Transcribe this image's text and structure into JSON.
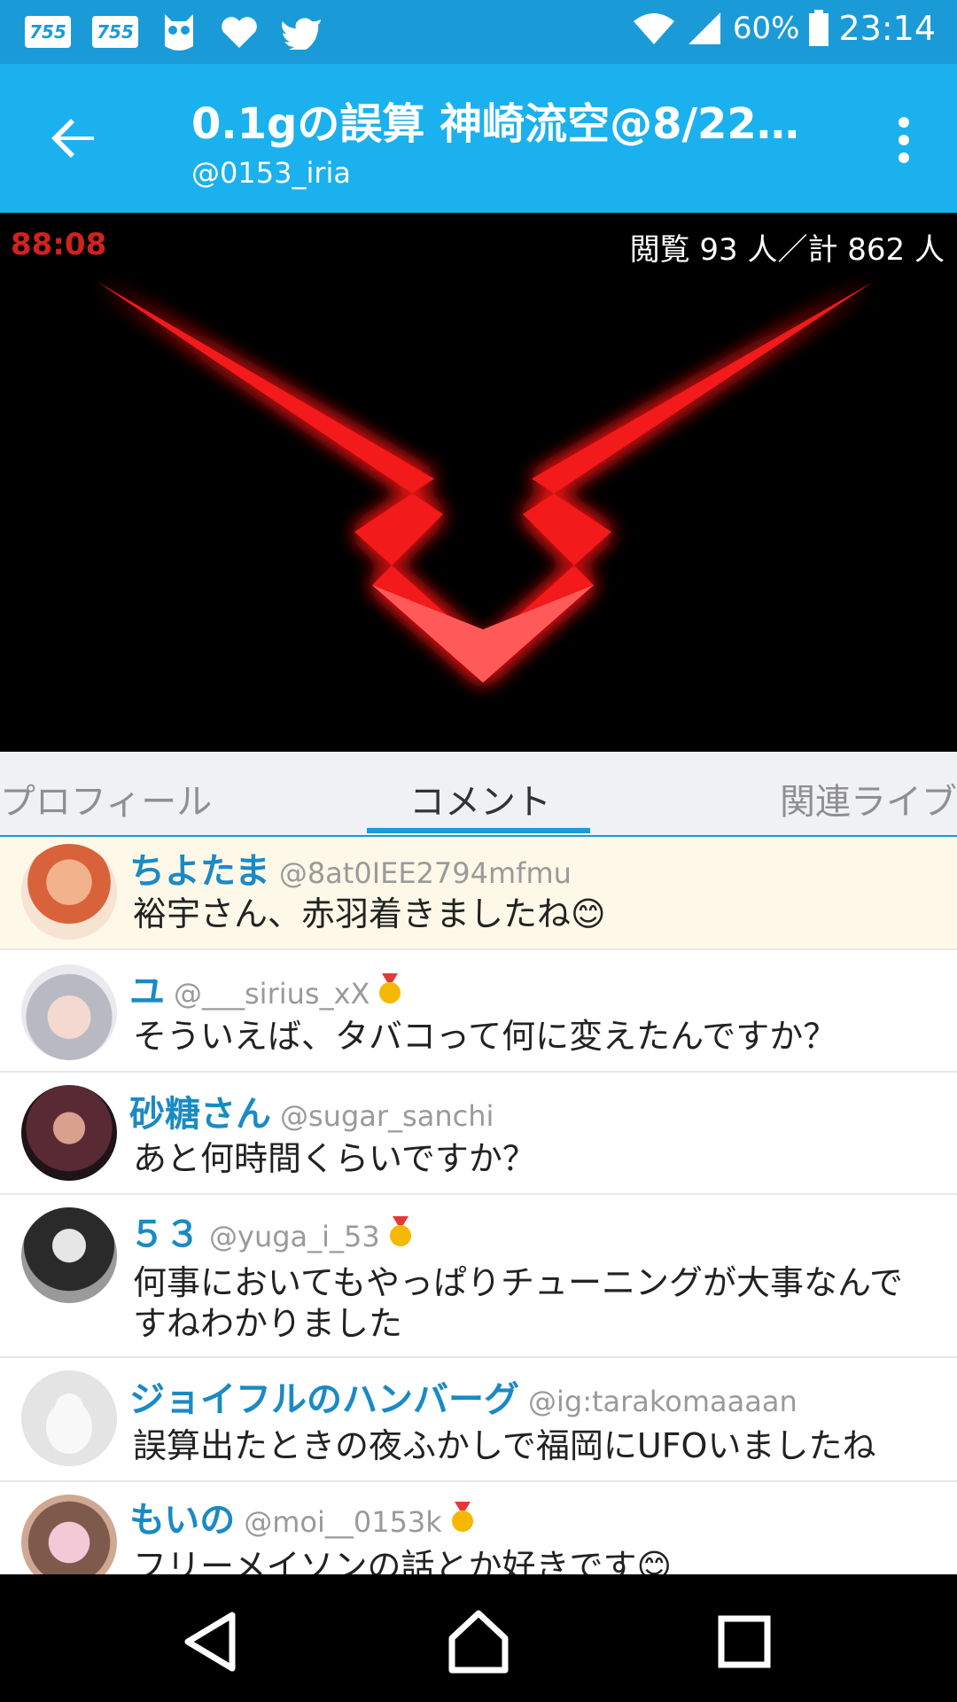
{
  "status_bar": {
    "notif_icons": [
      "755-icon",
      "755-icon",
      "owl-icon",
      "heart-icon",
      "twitter-icon"
    ],
    "badge_text": "755",
    "battery": "60%",
    "time": "23:14"
  },
  "app_bar": {
    "title": "0.1gの誤算 神崎流空@8/22…",
    "subtitle": "@0153_iria"
  },
  "video": {
    "timer": "88:08",
    "viewers": "閲覧 93 人／計 862 人"
  },
  "tabs": [
    {
      "label": "プロフィール"
    },
    {
      "label": "コメント"
    },
    {
      "label": "関連ライブ"
    }
  ],
  "comments": [
    {
      "name": "ちよたま",
      "handle": "@8at0IEE2794mfmu",
      "text": "裕宇さん、赤羽着きましたね😊",
      "medal": false
    },
    {
      "name": "ユ",
      "handle": "@___sirius_xX",
      "text": "そういえば、タバコって何に変えたんですか？",
      "medal": true
    },
    {
      "name": "砂糖さん",
      "handle": "@sugar_sanchi",
      "text": "あと何時間くらいですか？",
      "medal": false
    },
    {
      "name": "５３",
      "handle": "@yuga_i_53",
      "text": "何事においてもやっぱりチューニングが大事なんですねわかりました",
      "medal": true
    },
    {
      "name": "ジョイフルのハンバーグ",
      "handle": "@ig:tarakomaaaan",
      "text": "誤算出たときの夜ふかしで福岡にUFOいましたね",
      "medal": false
    },
    {
      "name": "もいの",
      "handle": "@moi__0153k",
      "text": "フリーメイソンの話とか好きです😊",
      "medal": true
    }
  ],
  "colors": {
    "accent": "#1ab1ee",
    "status": "#1a9bd8",
    "timer": "#d3221c",
    "name": "#1a8ac4",
    "highlight": "#fdf8e8"
  }
}
